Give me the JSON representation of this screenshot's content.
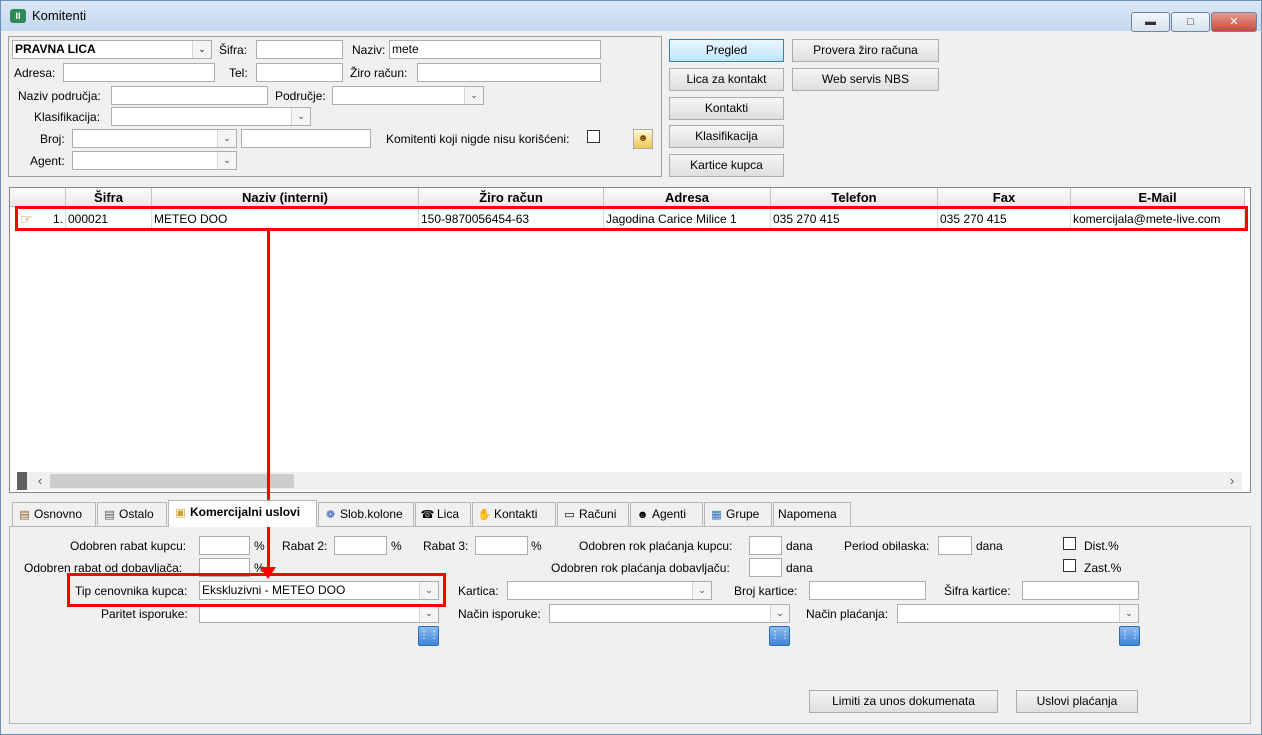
{
  "window": {
    "title": "Komitenti",
    "icon": "app-logo-icon"
  },
  "filter": {
    "type_value": "PRAVNA LICA",
    "sifra_label": "Šifra:",
    "sifra_value": "",
    "naziv_label": "Naziv:",
    "naziv_value": "mete",
    "adresa_label": "Adresa:",
    "adresa_value": "",
    "tel_label": "Tel:",
    "tel_value": "",
    "ziro_label": "Žiro račun:",
    "ziro_value": "",
    "naziv_podrucja_label": "Naziv područja:",
    "naziv_podrucja_value": "",
    "podrucje_label": "Područje:",
    "podrucje_value": "",
    "klasifikacija_label": "Klasifikacija:",
    "klasifikacija_value": "",
    "broj_label": "Broj:",
    "broj_value": "",
    "broj_text_value": "",
    "agent_label": "Agent:",
    "agent_value": "",
    "unused_label": "Komitenti koji nigde nisu korišćeni:"
  },
  "buttons": {
    "pregled": "Pregled",
    "lica_za_kontakt": "Lica za kontakt",
    "kontakti": "Kontakti",
    "klasifikacija": "Klasifikacija",
    "kartice_kupca": "Kartice kupca",
    "provera": "Provera žiro računa",
    "web_servis": "Web servis NBS"
  },
  "grid": {
    "columns": [
      "Šifra",
      "Naziv (interni)",
      "Žiro račun",
      "Adresa",
      "Telefon",
      "Fax",
      "E-Mail"
    ],
    "rows": [
      {
        "num": "1.",
        "sifra": "000021",
        "naziv": "METEO DOO",
        "ziro": "150-9870056454-63",
        "adresa": "Jagodina Carice Milice 1",
        "telefon": "035 270 415",
        "fax": "035 270 415",
        "email": "komercijala@mete-live.com"
      }
    ]
  },
  "tabs": [
    {
      "label": "Osnovno",
      "icon": "books-icon"
    },
    {
      "label": "Ostalo",
      "icon": "document-icon"
    },
    {
      "label": "Komercijalni uslovi",
      "icon": "folder-icon"
    },
    {
      "label": "Slob.kolone",
      "icon": "butterfly-icon"
    },
    {
      "label": "Lica",
      "icon": "phone-icon"
    },
    {
      "label": "Kontakti",
      "icon": "hand-icon"
    },
    {
      "label": "Računi",
      "icon": "card-icon"
    },
    {
      "label": "Agenti",
      "icon": "agent-icon"
    },
    {
      "label": "Grupe",
      "icon": "groups-icon"
    },
    {
      "label": "Napomena",
      "icon": ""
    }
  ],
  "komercijalni": {
    "rabat_kupcu_label": "Odobren rabat kupcu:",
    "rabat_kupcu_value": "",
    "pct1": "%",
    "rabat2_label": "Rabat 2:",
    "rabat2_value": "",
    "pct2": "%",
    "rabat3_label": "Rabat 3:",
    "rabat3_value": "",
    "pct3": "%",
    "rok_kupcu_label": "Odobren rok plaćanja kupcu:",
    "rok_kupcu_value": "",
    "dana1": "dana",
    "period_label": "Period obilaska:",
    "period_value": "",
    "dana2": "dana",
    "dist_label": "Dist.%",
    "rabat_dob_label": "Odobren rabat od dobavljača:",
    "rabat_dob_value": "",
    "pct4": "%",
    "rok_dob_label": "Odobren rok plaćanja dobavljaču:",
    "rok_dob_value": "",
    "dana3": "dana",
    "zast_label": "Zast.%",
    "tip_label": "Tip cenovnika kupca:",
    "tip_value": "Ekskluzivni - METEO DOO",
    "kartica_label": "Kartica:",
    "kartica_value": "",
    "broj_kartice_label": "Broj kartice:",
    "broj_kartice_value": "",
    "sifra_kartice_label": "Šifra kartice:",
    "sifra_kartice_value": "",
    "paritet_label": "Paritet isporuke:",
    "paritet_value": "",
    "nacin_isporuke_label": "Način isporuke:",
    "nacin_isporuke_value": "",
    "nacin_placanja_label": "Način plaćanja:",
    "nacin_placanja_value": "",
    "limiti_button": "Limiti za unos dokumenata",
    "uslovi_button": "Uslovi plaćanja"
  }
}
